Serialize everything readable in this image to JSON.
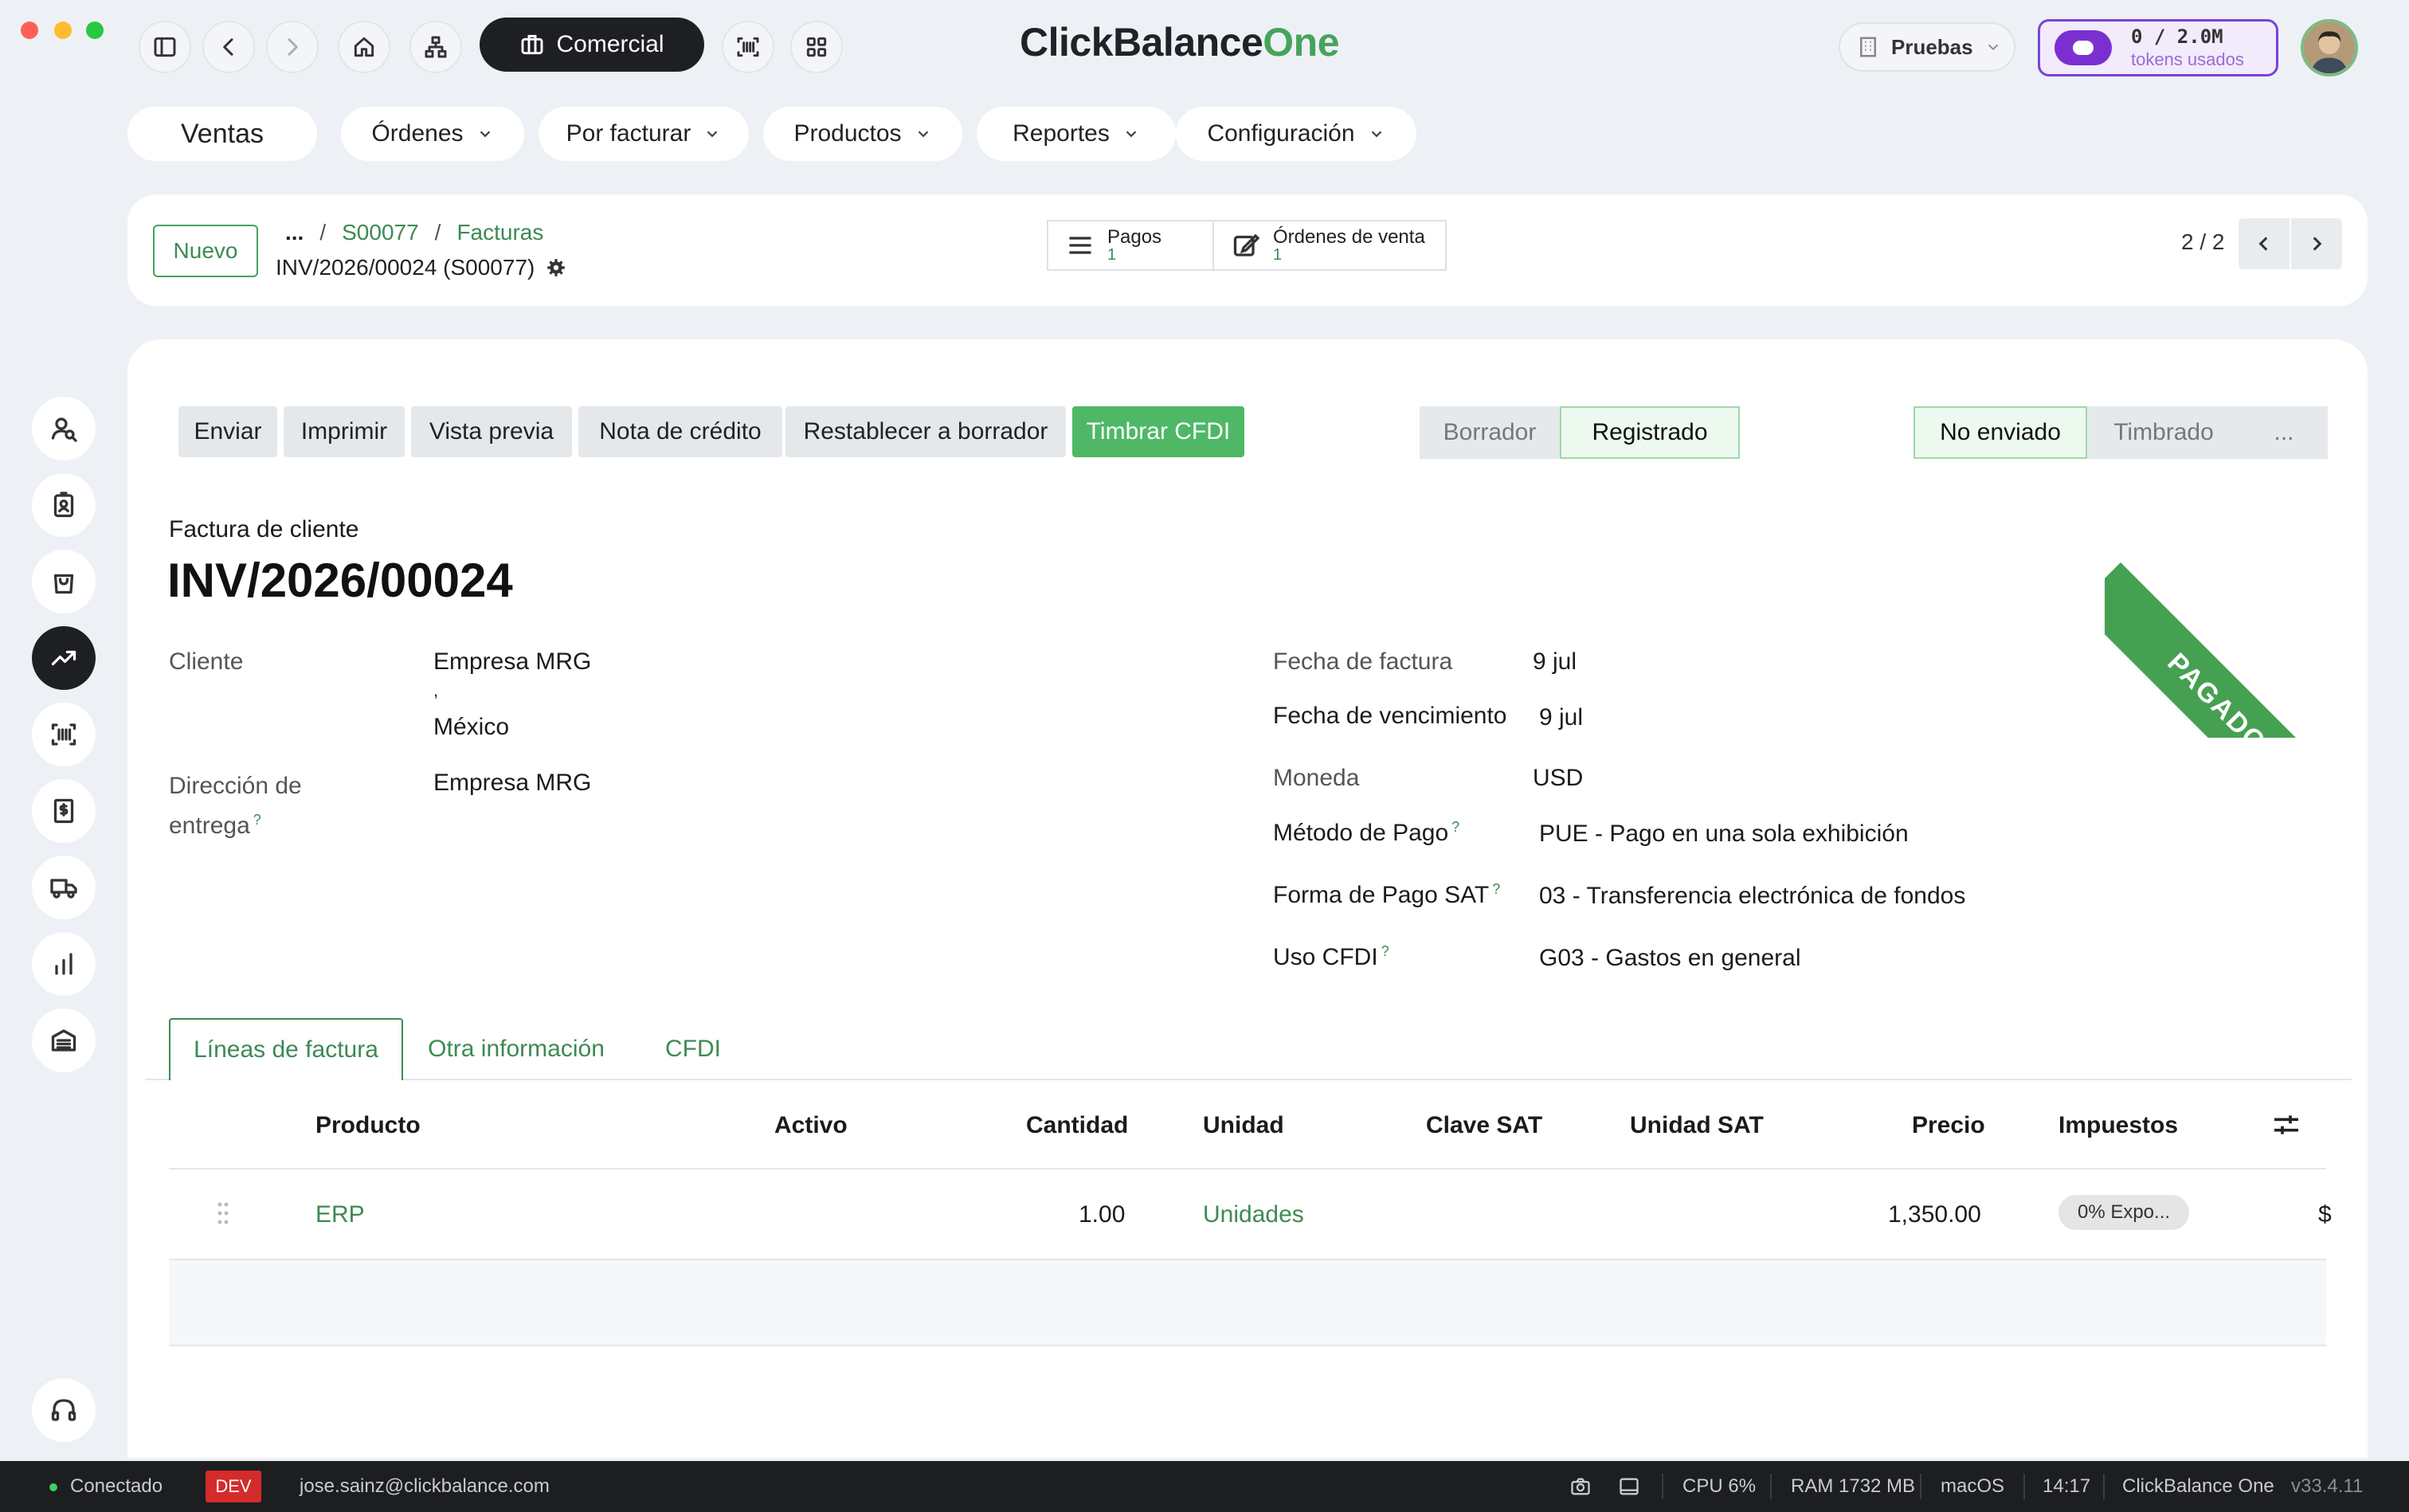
{
  "window": {
    "controls": {
      "close_color": "#ff5f57",
      "minimize_color": "#febc2e",
      "maximize_color": "#28c840"
    }
  },
  "topbar": {
    "app_button_label": "Comercial",
    "brand_main": "ClickBalance",
    "brand_accent": "One",
    "brand_accent_color": "#47a35a",
    "company_label": "Pruebas",
    "tokens_value": "0 / 2.0M",
    "tokens_label": "tokens usados"
  },
  "menu": {
    "items": [
      {
        "label": "Ventas"
      },
      {
        "label": "Órdenes"
      },
      {
        "label": "Por facturar"
      },
      {
        "label": "Productos"
      },
      {
        "label": "Reportes"
      },
      {
        "label": "Configuración"
      }
    ]
  },
  "breadcrumb": {
    "new_label": "Nuevo",
    "ellipsis": "...",
    "sep": "/",
    "order": "S00077",
    "section": "Facturas",
    "record": "INV/2026/00024 (S00077)"
  },
  "smart_buttons": {
    "payments_label": "Pagos",
    "payments_count": "1",
    "orders_label": "Órdenes de venta",
    "orders_count": "1"
  },
  "pager": {
    "text": "2 / 2"
  },
  "actions": {
    "send": "Enviar",
    "print": "Imprimir",
    "preview": "Vista previa",
    "credit_note": "Nota de crédito",
    "reset": "Restablecer a borrador",
    "stamp": "Timbrar CFDI"
  },
  "state_bar": {
    "draft": "Borrador",
    "posted": "Registrado"
  },
  "cfdi_bar": {
    "not_sent": "No enviado",
    "stamped": "Timbrado",
    "more": "..."
  },
  "ribbon": {
    "label": "PAGADO",
    "color": "#46a052"
  },
  "invoice": {
    "type_label": "Factura de cliente",
    "number": "INV/2026/00024",
    "customer_label": "Cliente",
    "customer_name": "Empresa MRG",
    "customer_comma": ",",
    "customer_country": "México",
    "delivery_label_1": "Dirección de",
    "delivery_label_2": "entrega",
    "delivery_value": "Empresa MRG",
    "tooltip_mark": "?",
    "date_label": "Fecha de factura",
    "date_value": "9 jul",
    "due_label": "Fecha de vencimiento",
    "due_value": "9 jul",
    "currency_label": "Moneda",
    "currency_value": "USD",
    "payment_method_label": "Método de Pago",
    "payment_method_value": "PUE - Pago en una sola exhibición",
    "payment_form_label": "Forma de Pago SAT",
    "payment_form_value": "03 - Transferencia electrónica de fondos",
    "cfdi_use_label": "Uso CFDI",
    "cfdi_use_value": "G03 - Gastos en general"
  },
  "tabs": [
    {
      "label": "Líneas de factura"
    },
    {
      "label": "Otra información"
    },
    {
      "label": "CFDI"
    }
  ],
  "table": {
    "headers": [
      "Producto",
      "Activo",
      "Cantidad",
      "Unidad",
      "Clave SAT",
      "Unidad SAT",
      "Precio",
      "Impuestos"
    ],
    "rows": [
      {
        "product": "ERP",
        "quantity": "1.00",
        "unit": "Unidades",
        "price": "1,350.00",
        "tax": "0% Expo...",
        "subtotal_partial": "$"
      }
    ]
  },
  "statusbar": {
    "connected": "Conectado",
    "env": "DEV",
    "user": "jose.sainz@clickbalance.com",
    "cpu": "CPU 6%",
    "ram": "RAM 1732 MB",
    "os": "macOS",
    "time": "14:17",
    "app": "ClickBalance One",
    "version": "v33.4.11"
  }
}
